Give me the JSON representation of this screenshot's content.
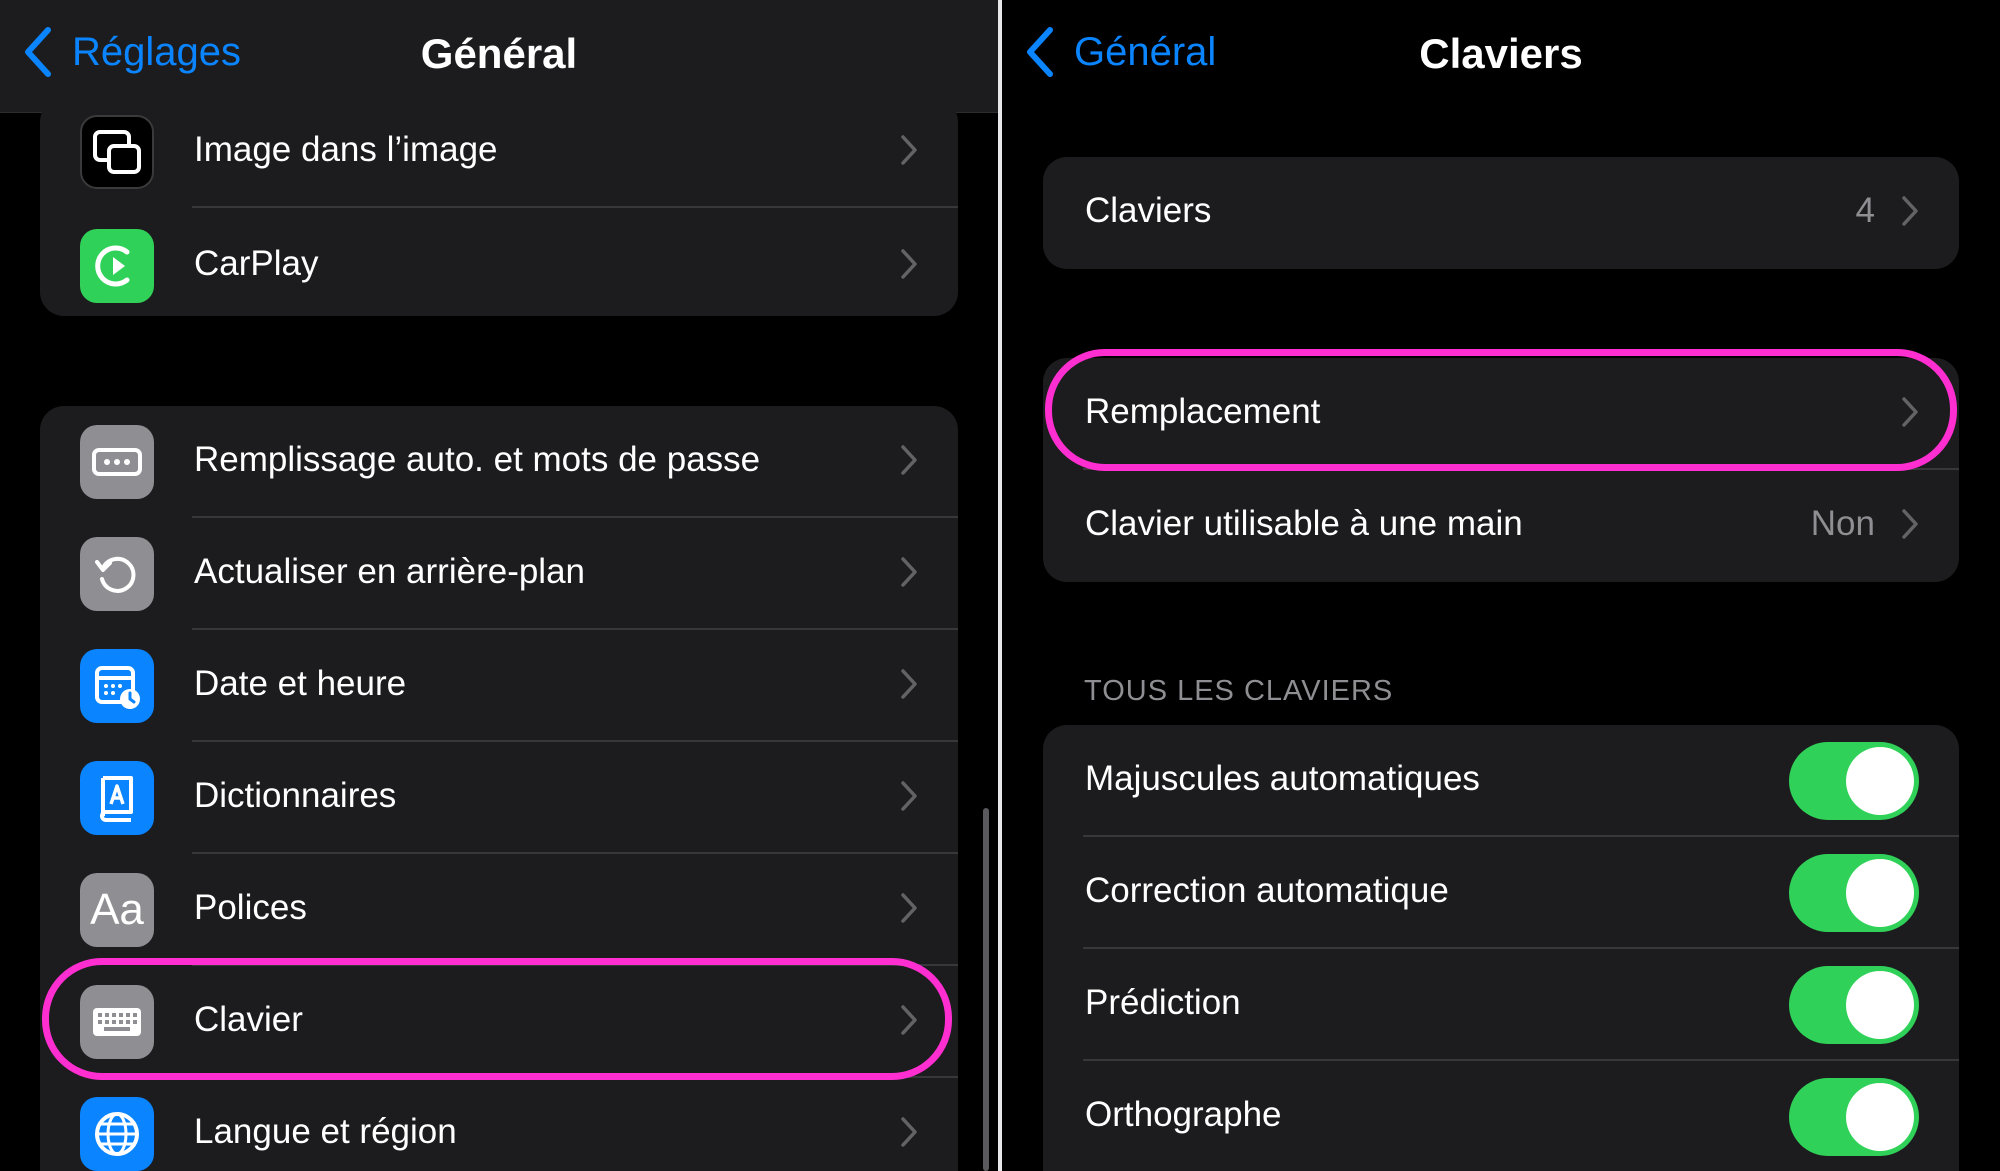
{
  "left": {
    "nav": {
      "back_label": "Réglages",
      "title": "Général"
    },
    "group1": [
      {
        "label": "Image dans l’image",
        "icon": "picture-in-picture-icon",
        "color": "#000000"
      },
      {
        "label": "CarPlay",
        "icon": "carplay-icon",
        "color": "#30d158"
      }
    ],
    "group2": [
      {
        "label": "Remplissage auto. et mots de passe",
        "icon": "password-dots-icon",
        "color": "#8e8e93"
      },
      {
        "label": "Actualiser en arrière-plan",
        "icon": "refresh-icon",
        "color": "#8e8e93"
      },
      {
        "label": "Date et heure",
        "icon": "calendar-clock-icon",
        "color": "#0a84ff"
      },
      {
        "label": "Dictionnaires",
        "icon": "dictionary-icon",
        "color": "#0a84ff"
      },
      {
        "label": "Polices",
        "icon": "fonts-icon",
        "icon_text": "Aa",
        "color": "#8e8e93"
      },
      {
        "label": "Clavier",
        "icon": "keyboard-icon",
        "color": "#8e8e93",
        "highlighted": true
      },
      {
        "label": "Langue et région",
        "icon": "globe-icon",
        "color": "#0a84ff"
      }
    ]
  },
  "right": {
    "nav": {
      "back_label": "Général",
      "title": "Claviers"
    },
    "claviers": {
      "label": "Claviers",
      "value": "4"
    },
    "group2": [
      {
        "label": "Remplacement",
        "highlighted": true
      },
      {
        "label": "Clavier utilisable à une main",
        "value": "Non"
      }
    ],
    "section_header": "TOUS LES CLAVIERS",
    "toggles": [
      {
        "label": "Majuscules automatiques",
        "on": true
      },
      {
        "label": "Correction automatique",
        "on": true
      },
      {
        "label": "Prédiction",
        "on": true
      },
      {
        "label": "Orthographe",
        "on": true
      }
    ]
  },
  "colors": {
    "accent": "#0a84ff",
    "highlight": "#ff2ed0",
    "toggle_on": "#30d158",
    "cell": "#1c1c1e"
  }
}
